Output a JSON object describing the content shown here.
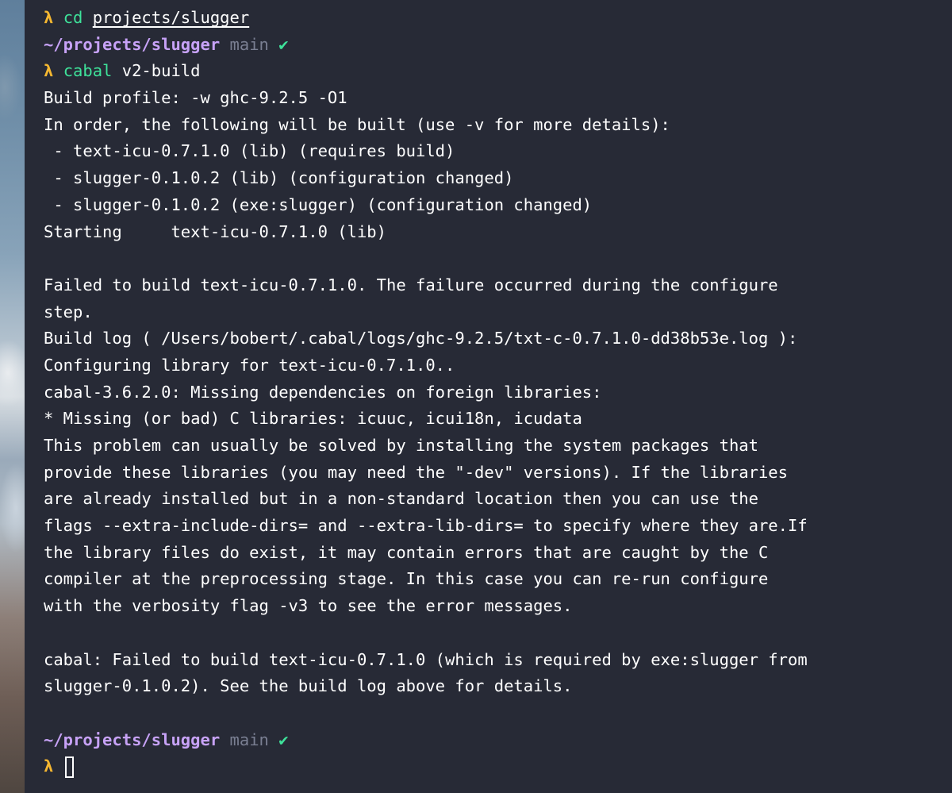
{
  "prompt_symbol": "λ",
  "check_symbol": "✔",
  "commands": {
    "cd": {
      "cmd": "cd",
      "arg": "projects/slugger"
    },
    "build": {
      "cmd": "cabal",
      "arg": "v2-build"
    }
  },
  "prompt_info": {
    "path": "~/projects/slugger",
    "branch": "main"
  },
  "output_lines": {
    "l1": "Build profile: -w ghc-9.2.5 -O1",
    "l2": "In order, the following will be built (use -v for more details):",
    "l3": " - text-icu-0.7.1.0 (lib) (requires build)",
    "l4": " - slugger-0.1.0.2 (lib) (configuration changed)",
    "l5": " - slugger-0.1.0.2 (exe:slugger) (configuration changed)",
    "l6": "Starting     text-icu-0.7.1.0 (lib)",
    "l7": "",
    "l8": "Failed to build text-icu-0.7.1.0. The failure occurred during the configure",
    "l9": "step.",
    "l10": "Build log ( /Users/bobert/.cabal/logs/ghc-9.2.5/txt-c-0.7.1.0-dd38b53e.log ):",
    "l11": "Configuring library for text-icu-0.7.1.0..",
    "l12": "cabal-3.6.2.0: Missing dependencies on foreign libraries:",
    "l13": "* Missing (or bad) C libraries: icuuc, icui18n, icudata",
    "l14": "This problem can usually be solved by installing the system packages that",
    "l15": "provide these libraries (you may need the \"-dev\" versions). If the libraries",
    "l16": "are already installed but in a non-standard location then you can use the",
    "l17": "flags --extra-include-dirs= and --extra-lib-dirs= to specify where they are.If",
    "l18": "the library files do exist, it may contain errors that are caught by the C",
    "l19": "compiler at the preprocessing stage. In this case you can re-run configure",
    "l20": "with the verbosity flag -v3 to see the error messages.",
    "l21": "",
    "l22": "cabal: Failed to build text-icu-0.7.1.0 (which is required by exe:slugger from",
    "l23": "slugger-0.1.0.2). See the build log above for details.",
    "l24": ""
  },
  "colors": {
    "background": "#272a36",
    "text": "#ffffff",
    "lambda": "#f5b731",
    "command": "#3ee29a",
    "path": "#c7a2f7",
    "branch": "#7a7f92",
    "check": "#3ee29a"
  }
}
